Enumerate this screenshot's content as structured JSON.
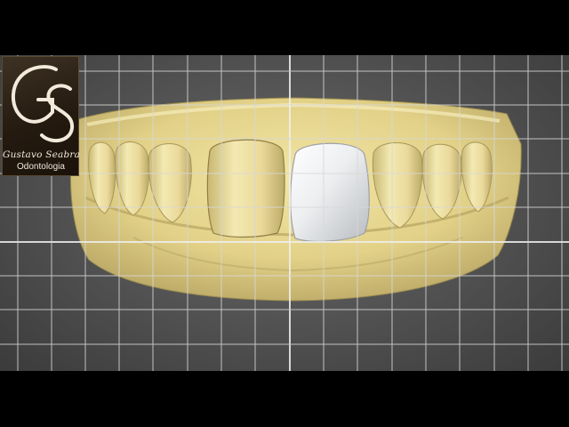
{
  "logo": {
    "monogram": "GS",
    "name": "Gustavo Seabra",
    "subtitle": "Odontologia"
  },
  "colors": {
    "stone_model": "#e6d68f",
    "crown": "#e9ecee",
    "grid": "#d8d8d8",
    "background": "#585858"
  },
  "icons": [
    "grid-overlay",
    "dental-model",
    "crown-restoration"
  ]
}
